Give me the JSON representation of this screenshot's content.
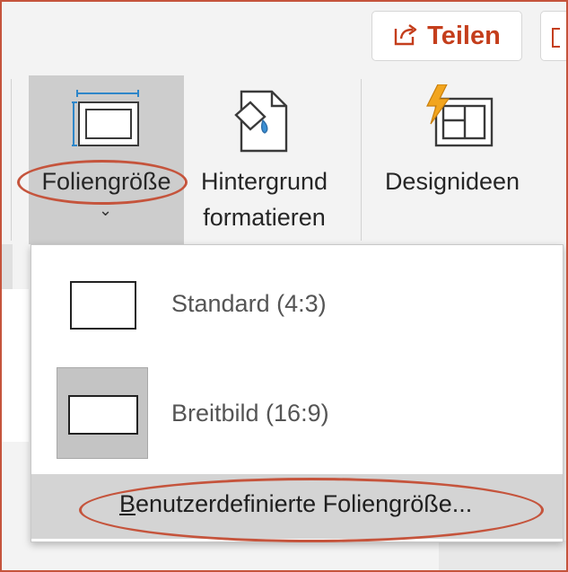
{
  "share": {
    "label": "Teilen"
  },
  "ribbon": {
    "slide_size": {
      "label": "Foliengröße",
      "chevron": "⌄"
    },
    "format_background": {
      "line1": "Hintergrund",
      "line2": "formatieren"
    },
    "design_ideas": {
      "label": "Designideen"
    }
  },
  "menu": {
    "standard": "Standard (4:3)",
    "widescreen": "Breitbild (16:9)",
    "custom_mnemonic": "B",
    "custom_rest": "enutzerdefinierte Foliengröße..."
  },
  "colors": {
    "accent": "#c43e1c",
    "annotation": "#c5543c",
    "lightning": "#f2a51e",
    "ruler_blue": "#2e86c9"
  }
}
